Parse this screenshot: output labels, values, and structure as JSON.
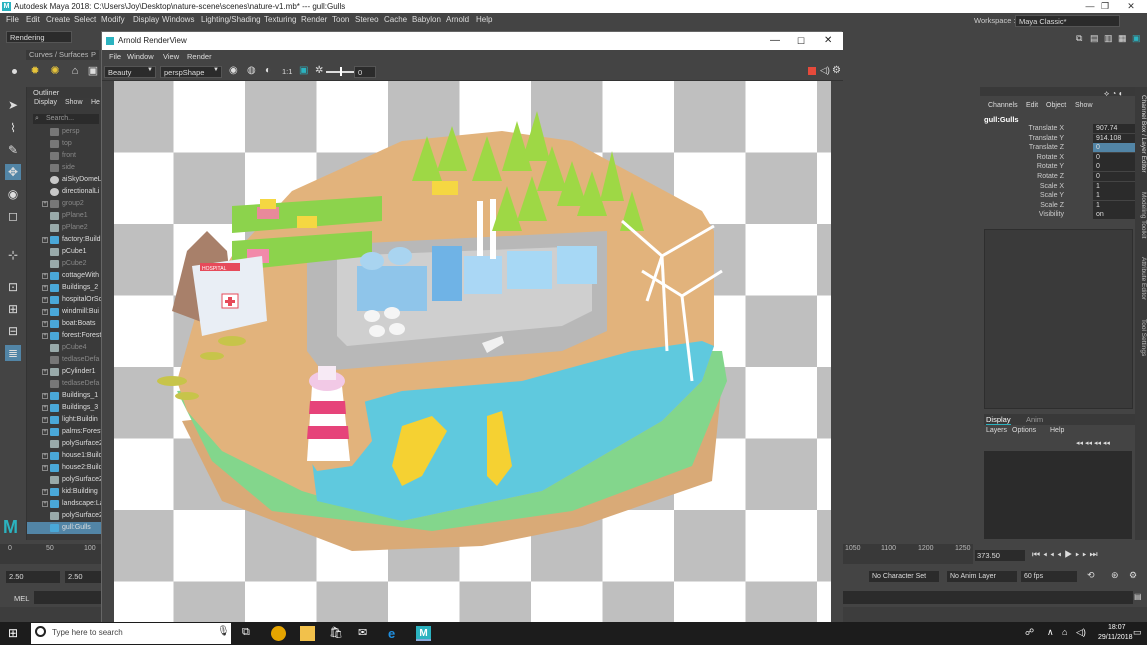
{
  "app": {
    "title": "Autodesk Maya 2018: C:\\Users\\Joy\\Desktop\\nature-scene\\scenes\\nature-v1.mb*   ---   gull:Gulls",
    "logo_letter": "M"
  },
  "menubar": [
    "File",
    "Edit",
    "Create",
    "Select",
    "Modify",
    "Display",
    "Windows",
    "Lighting/Shading",
    "Texturing",
    "Render",
    "Toon",
    "Stereo",
    "Cache",
    "Babylon",
    "Arnold",
    "Help"
  ],
  "workspace": {
    "label": "Workspace :",
    "value": "Maya Classic*"
  },
  "shelf": {
    "menu_set": "Rendering",
    "tabs": [
      "Curves / Surfaces",
      "P"
    ]
  },
  "outliner": {
    "title": "Outliner",
    "menu": [
      "Display",
      "Show",
      "He"
    ],
    "search_placeholder": "Search...",
    "items": [
      {
        "label": "persp",
        "dim": true,
        "plus": false,
        "icon": "camera"
      },
      {
        "label": "top",
        "dim": true,
        "plus": false,
        "icon": "camera"
      },
      {
        "label": "front",
        "dim": true,
        "plus": false,
        "icon": "camera"
      },
      {
        "label": "side",
        "dim": true,
        "plus": false,
        "icon": "camera"
      },
      {
        "label": "aiSkyDomeLi",
        "dim": false,
        "plus": false,
        "icon": "light"
      },
      {
        "label": "directionalLi",
        "dim": false,
        "plus": false,
        "icon": "light"
      },
      {
        "label": "group2",
        "dim": true,
        "plus": true,
        "icon": "group"
      },
      {
        "label": "pPlane1",
        "dim": true,
        "plus": false,
        "icon": "mesh"
      },
      {
        "label": "pPlane2",
        "dim": true,
        "plus": false,
        "icon": "mesh"
      },
      {
        "label": "factory:Build",
        "dim": false,
        "plus": true,
        "icon": "ref"
      },
      {
        "label": "pCube1",
        "dim": false,
        "plus": false,
        "icon": "mesh"
      },
      {
        "label": "pCube2",
        "dim": true,
        "plus": false,
        "icon": "mesh"
      },
      {
        "label": "cottageWith",
        "dim": false,
        "plus": true,
        "icon": "ref"
      },
      {
        "label": "Buildings_2",
        "dim": false,
        "plus": true,
        "icon": "ref"
      },
      {
        "label": "hospitalOrSo",
        "dim": false,
        "plus": true,
        "icon": "ref"
      },
      {
        "label": "windmill:Bui",
        "dim": false,
        "plus": true,
        "icon": "ref"
      },
      {
        "label": "boat:Boats",
        "dim": false,
        "plus": true,
        "icon": "ref"
      },
      {
        "label": "forest:Forest",
        "dim": false,
        "plus": true,
        "icon": "ref"
      },
      {
        "label": "pCube4",
        "dim": true,
        "plus": false,
        "icon": "mesh"
      },
      {
        "label": "tedlaseDefa",
        "dim": true,
        "plus": false,
        "icon": "set"
      },
      {
        "label": "pCylinder1",
        "dim": false,
        "plus": true,
        "icon": "mesh"
      },
      {
        "label": "tedlaseDefa",
        "dim": true,
        "plus": false,
        "icon": "set"
      },
      {
        "label": "Buildings_1",
        "dim": false,
        "plus": true,
        "icon": "ref"
      },
      {
        "label": "Buildings_3",
        "dim": false,
        "plus": true,
        "icon": "ref"
      },
      {
        "label": "light:Buildin",
        "dim": false,
        "plus": true,
        "icon": "ref"
      },
      {
        "label": "palms:Forest",
        "dim": false,
        "plus": true,
        "icon": "ref"
      },
      {
        "label": "polySurface2",
        "dim": false,
        "plus": false,
        "icon": "mesh"
      },
      {
        "label": "house1:Build",
        "dim": false,
        "plus": true,
        "icon": "ref"
      },
      {
        "label": "house2:Build",
        "dim": false,
        "plus": true,
        "icon": "ref"
      },
      {
        "label": "polySurface2",
        "dim": false,
        "plus": false,
        "icon": "mesh"
      },
      {
        "label": "kid:Building",
        "dim": false,
        "plus": true,
        "icon": "ref"
      },
      {
        "label": "landscape:La",
        "dim": false,
        "plus": true,
        "icon": "ref"
      },
      {
        "label": "polySurface2",
        "dim": false,
        "plus": false,
        "icon": "mesh"
      },
      {
        "label": "gull:Gulls",
        "dim": false,
        "plus": false,
        "icon": "ref",
        "selected": true
      }
    ]
  },
  "renderview": {
    "title": "Arnold RenderView",
    "menu": [
      "File",
      "Window",
      "View",
      "Render"
    ],
    "aov": "Beauty",
    "camera": "perspShape",
    "ratio": "1:1",
    "exposure": "0",
    "labels": {
      "hospital": "HOSPITAL"
    }
  },
  "channelbox": {
    "menu": [
      "Channels",
      "Edit",
      "Object",
      "Show"
    ],
    "object": "gull:Gulls",
    "attrs": [
      {
        "label": "Translate X",
        "value": "907.74",
        "active": false
      },
      {
        "label": "Translate Y",
        "value": "914.108",
        "active": false
      },
      {
        "label": "Translate Z",
        "value": "0",
        "active": true
      },
      {
        "label": "Rotate X",
        "value": "0",
        "active": false
      },
      {
        "label": "Rotate Y",
        "value": "0",
        "active": false
      },
      {
        "label": "Rotate Z",
        "value": "0",
        "active": false
      },
      {
        "label": "Scale X",
        "value": "1",
        "active": false
      },
      {
        "label": "Scale Y",
        "value": "1",
        "active": false
      },
      {
        "label": "Scale Z",
        "value": "1",
        "active": false
      },
      {
        "label": "Visibility",
        "value": "on",
        "active": false
      }
    ],
    "layer_tabs": [
      "Display",
      "Anim"
    ],
    "layer_menu": [
      "Layers",
      "Options",
      "Help"
    ]
  },
  "sidetabs": [
    "Channel Box / Layer Editor",
    "Modeling Toolkit",
    "Attribute Editor",
    "Tool Settings"
  ],
  "timeline": {
    "ticks": [
      "0",
      "50",
      "100"
    ],
    "ticks_right": [
      "1050",
      "1100",
      "1150",
      "1200",
      "1250"
    ],
    "current_frame": "373.50",
    "range_start": "2.50",
    "range_start2": "2.50",
    "character_set": "No Character Set",
    "anim_layer": "No Anim Layer",
    "fps": "60 fps",
    "cmd_label": "MEL"
  },
  "taskbar": {
    "search_placeholder": "Type here to search",
    "time": "18:07",
    "date": "29/11/2018"
  },
  "colors": {
    "maya_teal": "#2bb3c0",
    "selected": "#5285a6",
    "active_field": "#5285a6",
    "orange_render": "#e64a3b"
  }
}
